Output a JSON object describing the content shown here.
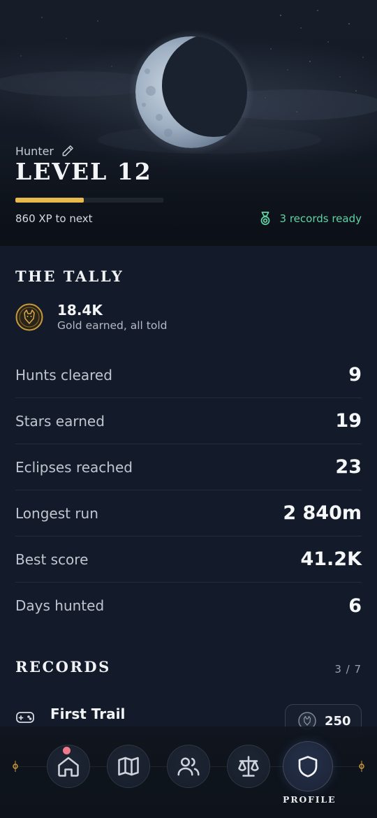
{
  "hero": {
    "player_class": "Hunter",
    "level_title": "LEVEL 12",
    "xp_progress": 0.46,
    "xp_next": "860 XP to next",
    "records_ready": "3 records ready"
  },
  "tally": {
    "title": "THE TALLY",
    "gold_value": "18.4K",
    "gold_label": "Gold earned, all told",
    "stats": [
      {
        "label": "Hunts cleared",
        "value": "9"
      },
      {
        "label": "Stars earned",
        "value": "19"
      },
      {
        "label": "Eclipses reached",
        "value": "23"
      },
      {
        "label": "Longest run",
        "value": "2 840m"
      },
      {
        "label": "Best score",
        "value": "41.2K"
      },
      {
        "label": "Days hunted",
        "value": "6"
      }
    ]
  },
  "records": {
    "title": "RECORDS",
    "count": "3 / 7",
    "items": [
      {
        "name": "First Trail",
        "reward": "250",
        "icon": "gamepad-icon"
      }
    ]
  },
  "nav": {
    "items": [
      {
        "name": "home",
        "icon": "home-icon",
        "has_notification": true
      },
      {
        "name": "map",
        "icon": "map-icon"
      },
      {
        "name": "friends",
        "icon": "users-icon"
      },
      {
        "name": "justice",
        "icon": "scales-icon"
      },
      {
        "name": "profile",
        "icon": "shield-icon",
        "active": true
      }
    ],
    "active_label": "PROFILE"
  },
  "colors": {
    "accent_gold": "#e8b94c",
    "accent_green": "#5fd3a3",
    "background": "#131b2a",
    "notification": "#f07a8a"
  }
}
